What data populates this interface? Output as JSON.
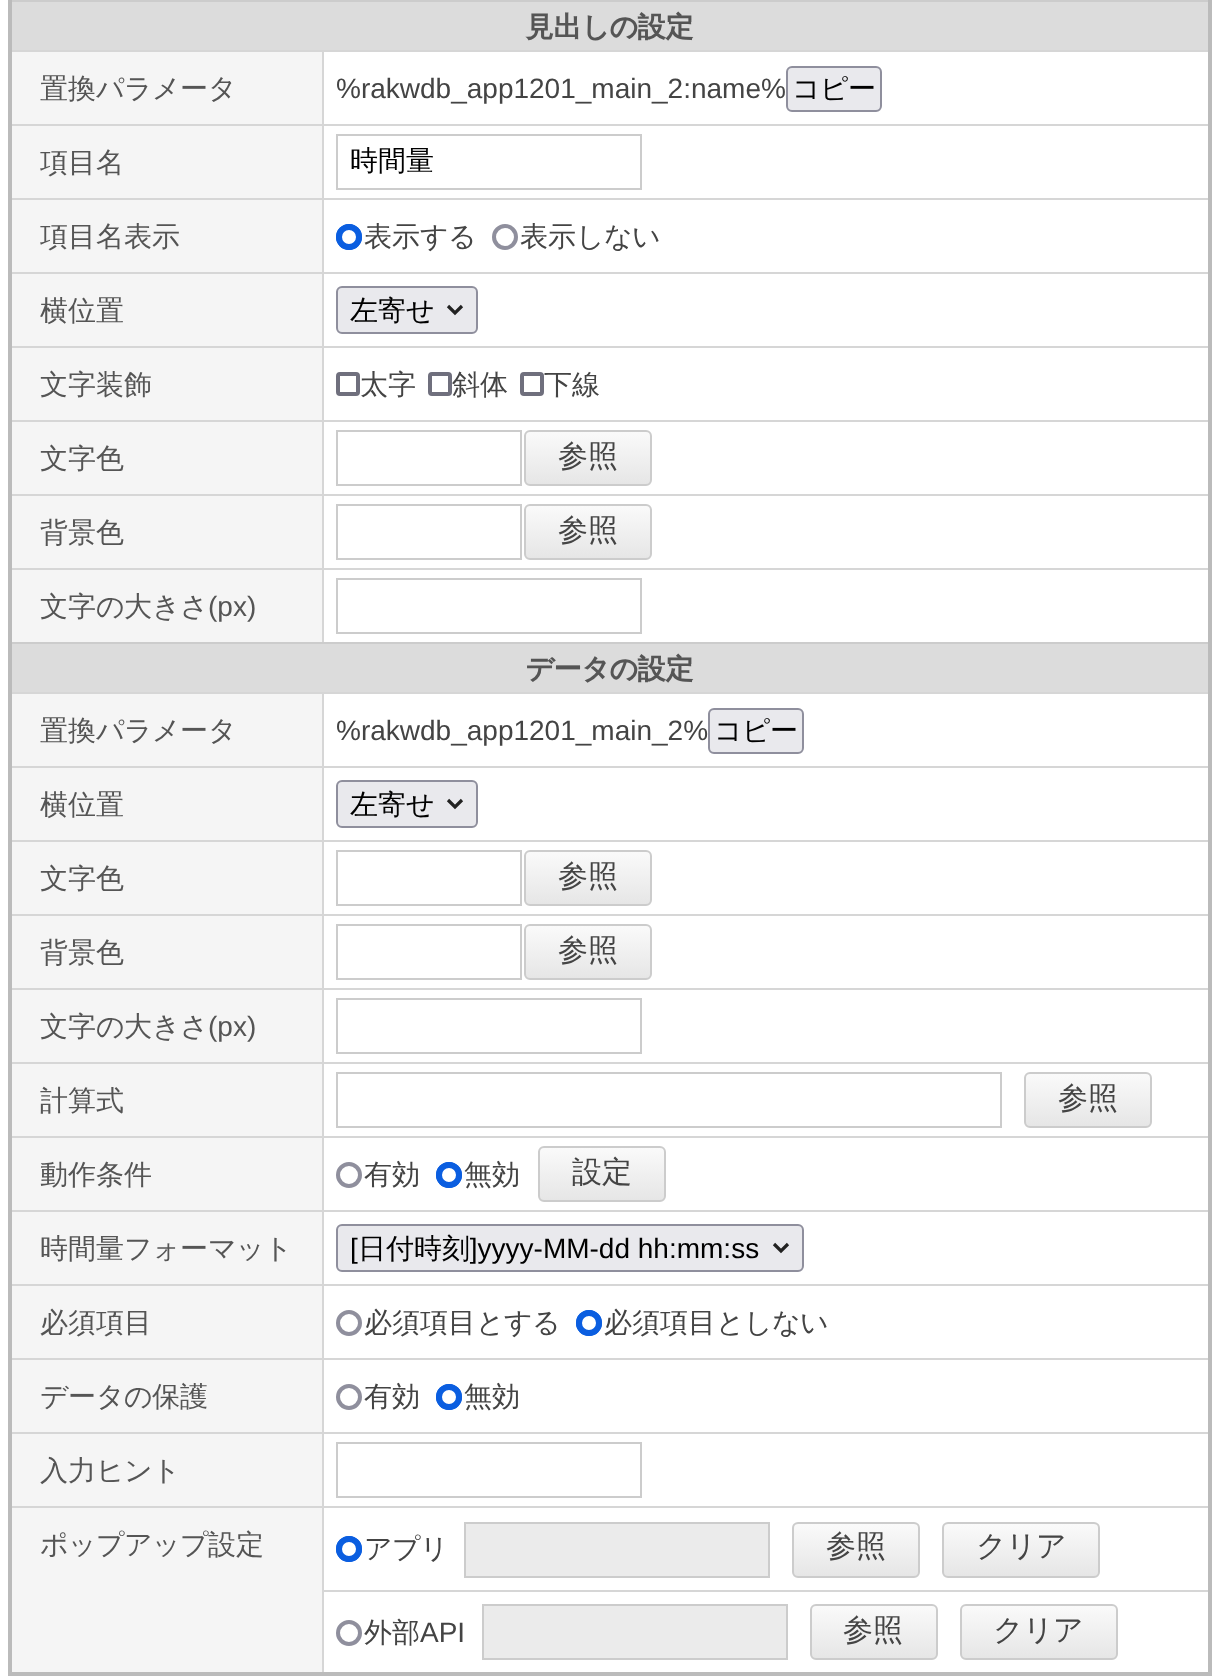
{
  "sections": [
    {
      "title": "見出しの設定",
      "rows": [
        {
          "label": "置換パラメータ",
          "lines": [
            [
              {
                "kind": "param",
                "text": "%rakwdb_app1201_main_2:name%"
              },
              {
                "kind": "copy",
                "label": "コピー"
              }
            ]
          ]
        },
        {
          "label": "項目名",
          "lines": [
            [
              {
                "kind": "input",
                "value": "時間量"
              }
            ]
          ]
        },
        {
          "label": "項目名表示",
          "lines": [
            [
              {
                "kind": "radio",
                "label": "表示する",
                "selected": true
              },
              {
                "kind": "radio",
                "label": "表示しない",
                "selected": false
              }
            ]
          ]
        },
        {
          "label": "横位置",
          "lines": [
            [
              {
                "kind": "select",
                "value": "左寄せ"
              }
            ]
          ]
        },
        {
          "label": "文字装飾",
          "lines": [
            [
              {
                "kind": "checkbox",
                "label": "太字",
                "checked": false
              },
              {
                "kind": "checkbox",
                "label": "斜体",
                "checked": false
              },
              {
                "kind": "checkbox",
                "label": "下線",
                "checked": false
              }
            ]
          ]
        },
        {
          "label": "文字色",
          "lines": [
            [
              {
                "kind": "short_input"
              },
              {
                "kind": "button",
                "label": "参照"
              }
            ]
          ]
        },
        {
          "label": "背景色",
          "lines": [
            [
              {
                "kind": "short_input"
              },
              {
                "kind": "button",
                "label": "参照"
              }
            ]
          ]
        },
        {
          "label": "文字の大きさ(px)",
          "lines": [
            [
              {
                "kind": "input"
              }
            ]
          ]
        }
      ]
    },
    {
      "title": "データの設定",
      "rows": [
        {
          "label": "置換パラメータ",
          "lines": [
            [
              {
                "kind": "param",
                "text": "%rakwdb_app1201_main_2%"
              },
              {
                "kind": "copy",
                "label": "コピー"
              }
            ]
          ]
        },
        {
          "label": "横位置",
          "lines": [
            [
              {
                "kind": "select",
                "value": "左寄せ"
              }
            ]
          ]
        },
        {
          "label": "文字色",
          "lines": [
            [
              {
                "kind": "short_input"
              },
              {
                "kind": "button",
                "label": "参照"
              }
            ]
          ]
        },
        {
          "label": "背景色",
          "lines": [
            [
              {
                "kind": "short_input"
              },
              {
                "kind": "button",
                "label": "参照"
              }
            ]
          ]
        },
        {
          "label": "文字の大きさ(px)",
          "lines": [
            [
              {
                "kind": "input"
              }
            ]
          ]
        },
        {
          "label": "計算式",
          "lines": [
            [
              {
                "kind": "wide_input"
              },
              {
                "kind": "button",
                "label": "参照"
              }
            ]
          ]
        },
        {
          "label": "動作条件",
          "lines": [
            [
              {
                "kind": "radio",
                "label": "有効",
                "selected": false
              },
              {
                "kind": "radio",
                "label": "無効",
                "selected": true
              },
              {
                "kind": "button",
                "label": "設定"
              }
            ]
          ]
        },
        {
          "label": "時間量フォーマット",
          "lines": [
            [
              {
                "kind": "select",
                "value": "[日付時刻]yyyy-MM-dd hh:mm:ss"
              }
            ]
          ]
        },
        {
          "label": "必須項目",
          "lines": [
            [
              {
                "kind": "radio",
                "label": "必須項目とする",
                "selected": false
              },
              {
                "kind": "radio",
                "label": "必須項目としない",
                "selected": true
              }
            ]
          ]
        },
        {
          "label": "データの保護",
          "lines": [
            [
              {
                "kind": "radio",
                "label": "有効",
                "selected": false
              },
              {
                "kind": "radio",
                "label": "無効",
                "selected": true
              }
            ]
          ]
        },
        {
          "label": "入力ヒント",
          "lines": [
            [
              {
                "kind": "input"
              }
            ]
          ]
        },
        {
          "label": "ポップアップ設定",
          "lines": [
            [
              {
                "kind": "radio",
                "label": "アプリ",
                "selected": true
              },
              {
                "kind": "disabled_input"
              },
              {
                "kind": "button",
                "label": "参照"
              },
              {
                "kind": "button",
                "label": "クリア"
              }
            ],
            [
              {
                "kind": "radio",
                "label": "外部API",
                "selected": false
              },
              {
                "kind": "disabled_input"
              },
              {
                "kind": "button",
                "label": "参照"
              },
              {
                "kind": "button",
                "label": "クリア"
              }
            ]
          ]
        }
      ]
    }
  ]
}
